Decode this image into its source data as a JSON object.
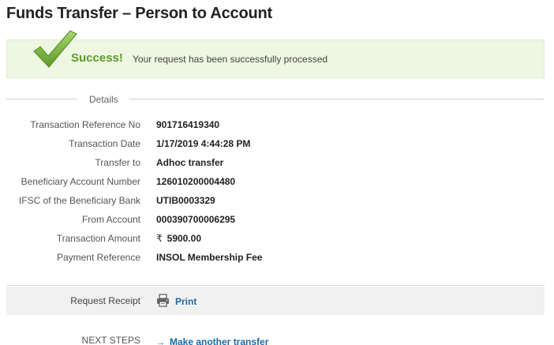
{
  "page": {
    "title": "Funds Transfer – Person to Account"
  },
  "success": {
    "title": "Success!",
    "message": "Your request has been successfully processed",
    "icon": "checkmark-icon",
    "color": "#5e9a2c"
  },
  "details": {
    "legend": "Details",
    "rows": [
      {
        "label": "Transaction Reference No",
        "value": "901716419340"
      },
      {
        "label": "Transaction Date",
        "value": "1/17/2019 4:44:28 PM"
      },
      {
        "label": "Transfer to",
        "value": "Adhoc transfer"
      },
      {
        "label": "Beneficiary Account Number",
        "value": "126010200004480"
      },
      {
        "label": "IFSC of the Beneficiary Bank",
        "value": "UTIB0003329"
      },
      {
        "label": "From Account",
        "value": "000390700006295"
      },
      {
        "label": "Transaction Amount",
        "currency": "₹",
        "value": "5900.00"
      },
      {
        "label": "Payment Reference",
        "value": "INSOL Membership Fee"
      }
    ]
  },
  "receipt": {
    "label": "Request Receipt",
    "print_label": "Print",
    "icon": "printer-icon"
  },
  "next_steps": {
    "label": "NEXT STEPS",
    "arrow": "→",
    "link_label": "Make another transfer"
  },
  "colors": {
    "link": "#1f6aa5",
    "success_bg": "#eef7e1"
  }
}
